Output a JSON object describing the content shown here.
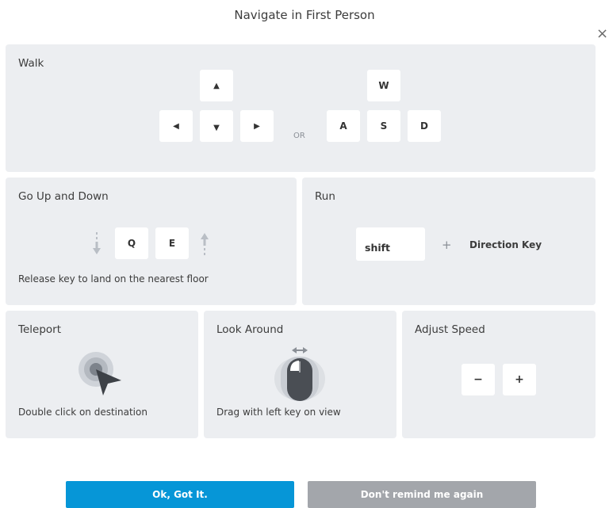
{
  "dialog": {
    "title": "Navigate in First Person",
    "close_glyph": "×"
  },
  "walk": {
    "title": "Walk",
    "arrows": {
      "up": "▲",
      "left": "◀",
      "down": "▼",
      "right": "▶"
    },
    "or_label": "OR",
    "keys": {
      "w": "W",
      "a": "A",
      "s": "S",
      "d": "D"
    }
  },
  "updown": {
    "title": "Go Up and Down",
    "keys": {
      "q": "Q",
      "e": "E"
    },
    "description": "Release key to land on the nearest floor"
  },
  "run": {
    "title": "Run",
    "key": "shift",
    "plus": "+",
    "direction_label": "Direction Key"
  },
  "teleport": {
    "title": "Teleport",
    "description": "Double click on destination"
  },
  "look": {
    "title": "Look Around",
    "description": "Drag with left key on view"
  },
  "speed": {
    "title": "Adjust Speed",
    "minus": "−",
    "plus": "+"
  },
  "buttons": {
    "ok_label": "Ok, Got It.",
    "dont_remind_label": "Don't remind me again"
  },
  "colors": {
    "panel_bg": "#eceef1",
    "primary_button": "#0696d7",
    "secondary_button": "#a3a6ab"
  },
  "icons": {
    "close": "close-icon",
    "down_arrow_indicator": "down-arrow-icon",
    "up_arrow_indicator": "up-arrow-icon",
    "teleport": "teleport-cursor-icon",
    "mouse": "mouse-icon",
    "horizontal_drag": "horizontal-drag-icon"
  }
}
